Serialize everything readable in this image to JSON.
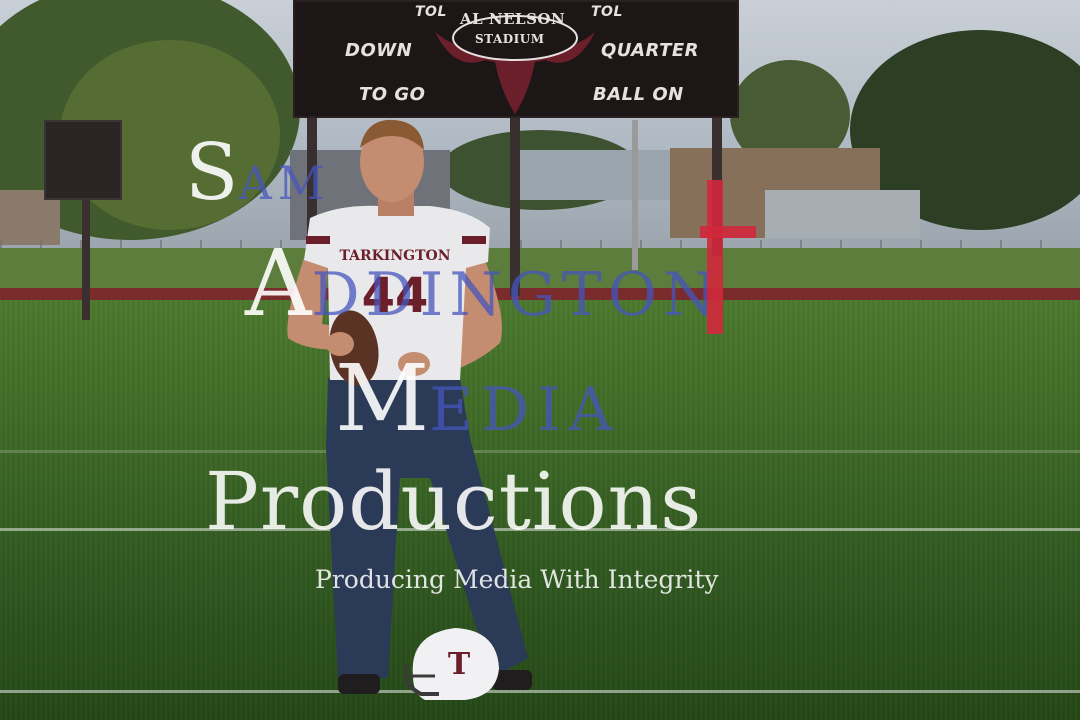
{
  "scoreboard": {
    "tol_left": "TOL",
    "tol_right": "TOL",
    "stadium_top": "AL NELSON",
    "stadium_bottom": "STADIUM",
    "down_label": "DOWN",
    "quarter_label": "QUARTER",
    "to_go_label": "TO GO",
    "ball_on_label": "BALL ON"
  },
  "player": {
    "jersey_name": "TARKINGTON",
    "jersey_number": "44"
  },
  "helmet": {
    "logo_letter": "T"
  },
  "watermark": {
    "s_letter": "S",
    "s_rest": "AM",
    "a_letter": "A",
    "a_rest": "DDINGTON",
    "m_letter": "M",
    "m_rest": "EDIA",
    "productions": "Productions",
    "tagline": "Producing Media With Integrity"
  },
  "colors": {
    "maroon": "#6b1f2a",
    "watermark_blue": "#4655be",
    "cross_red": "#d2283c",
    "field_green": "#3f6a27"
  }
}
